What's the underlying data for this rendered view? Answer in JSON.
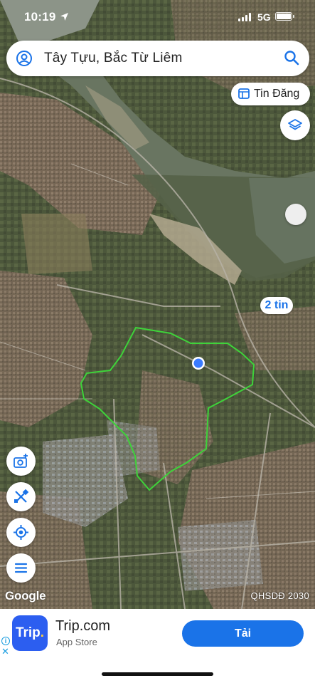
{
  "status_bar": {
    "time": "10:19",
    "network": "5G"
  },
  "search": {
    "query": "Tây Tựu, Bắc Từ Liêm",
    "account_icon": "account-circle-icon",
    "search_icon": "search-icon"
  },
  "controls": {
    "tin_dang_label": "Tin Đăng",
    "tin_dang_icon": "listing-icon",
    "layers_icon": "layers-icon",
    "listing_badge": "2 tin",
    "left_buttons": [
      "camera-add-icon",
      "measure-tools-icon",
      "my-location-icon",
      "menu-icon"
    ]
  },
  "map": {
    "attribution": "Google",
    "plan_label": "QHSDĐ 2030",
    "boundary_color": "#3ed33a",
    "location_dot_color": "#3a7bff"
  },
  "ad": {
    "logo_text": "Trip",
    "logo_dot": ".",
    "title": "Trip.com",
    "subtitle": "App Store",
    "cta": "Tải",
    "info_glyph": "i",
    "close_glyph": "✕",
    "accent": "#1a73e8"
  }
}
